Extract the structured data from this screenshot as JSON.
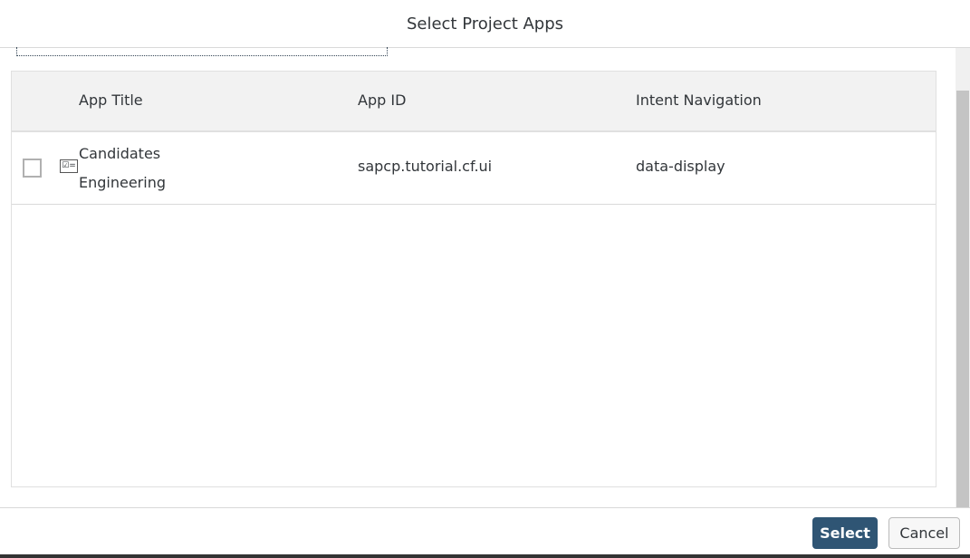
{
  "dialog": {
    "title": "Select Project Apps"
  },
  "table": {
    "columns": [
      "App Title",
      "App ID",
      "Intent Navigation"
    ],
    "rows": [
      {
        "icon": "task-list-icon",
        "title": "Candidates Engineering",
        "app_id": "sapcp.tutorial.cf.ui",
        "intent": "data-display",
        "checked": false
      }
    ]
  },
  "footer": {
    "select_label": "Select",
    "cancel_label": "Cancel"
  },
  "colors": {
    "primary_button": "#2f5574",
    "header_bg": "#f2f2f2"
  }
}
